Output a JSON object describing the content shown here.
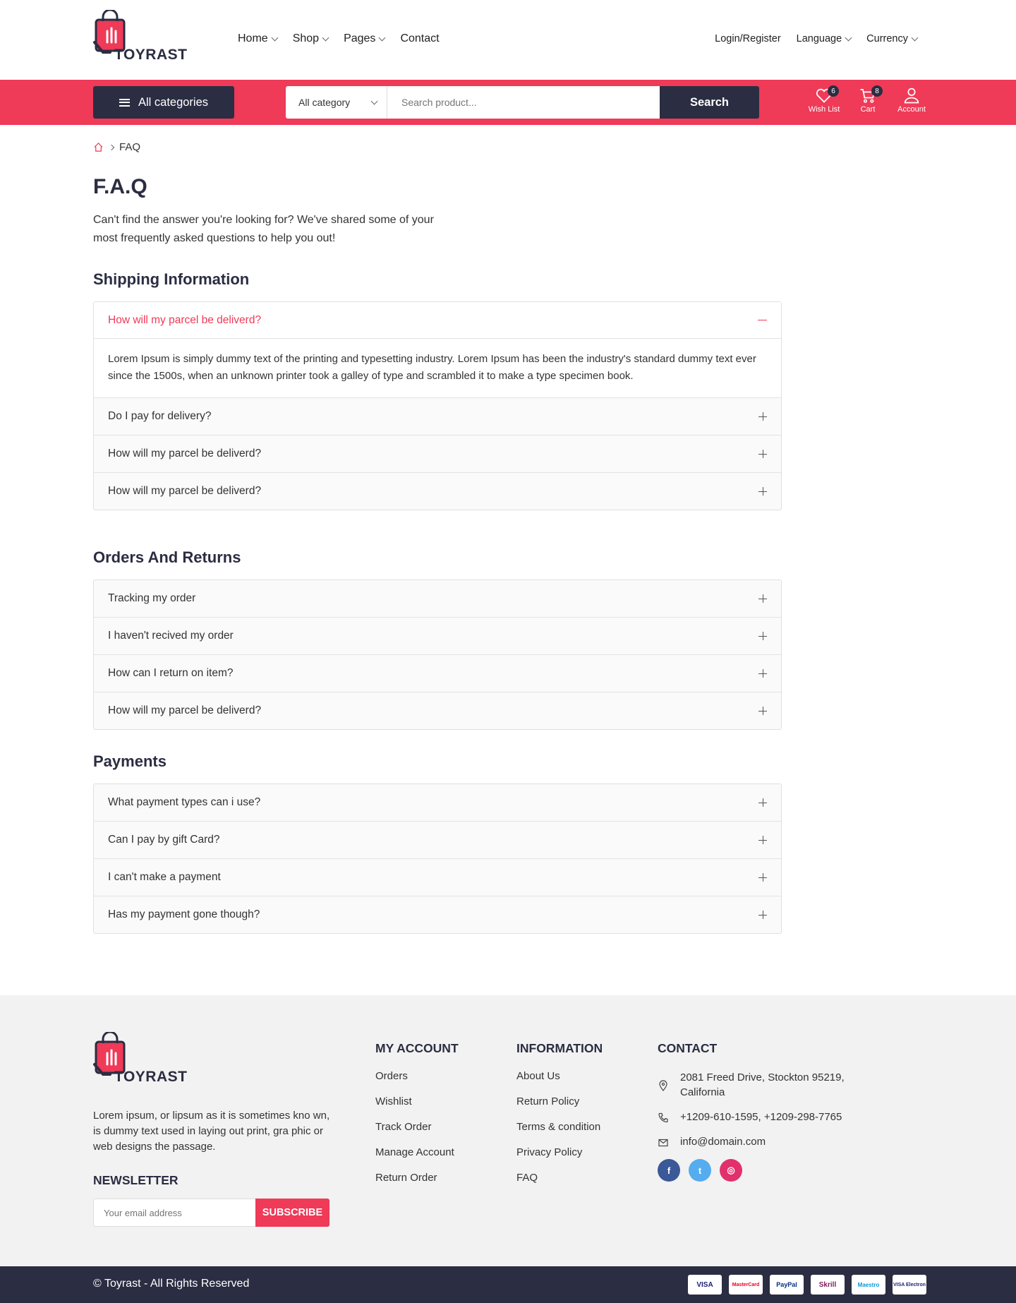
{
  "brand": {
    "name": "TOYRAST",
    "accent": "#ef3a58",
    "dark": "#2b2d42"
  },
  "nav": {
    "items": [
      {
        "label": "Home"
      },
      {
        "label": "Shop"
      },
      {
        "label": "Pages"
      },
      {
        "label": "Contact"
      }
    ],
    "login": "Login/Register",
    "language": "Language",
    "currency": "Currency"
  },
  "bar": {
    "all_categories": "All categories",
    "category_select": "All category",
    "search_placeholder": "Search product...",
    "search_button": "Search",
    "wishlist_label": "Wish List",
    "wishlist_count": "6",
    "cart_label": "Cart",
    "cart_count": "8",
    "account_label": "Account"
  },
  "breadcrumb": {
    "current": "FAQ"
  },
  "page": {
    "title": "F.A.Q",
    "subtitle": "Can't find the answer you're looking for? We've shared some of your most frequently asked questions to help you out!"
  },
  "sections": [
    {
      "title": "Shipping Information",
      "items": [
        {
          "q": "How will my parcel be deliverd?",
          "a": "Lorem Ipsum is simply dummy text of the printing and typesetting industry. Lorem Ipsum has been the industry's standard dummy text ever since the 1500s, when an unknown printer took a galley of type and scrambled it to make a type specimen book.",
          "open": true
        },
        {
          "q": "Do I pay for delivery?"
        },
        {
          "q": "How will my parcel be deliverd?"
        },
        {
          "q": "How will my parcel be deliverd?"
        }
      ]
    },
    {
      "title": "Orders And Returns",
      "items": [
        {
          "q": "Tracking my order"
        },
        {
          "q": "I haven't recived my order"
        },
        {
          "q": "How can I return on item?"
        },
        {
          "q": "How will my parcel be deliverd?"
        }
      ]
    },
    {
      "title": "Payments",
      "items": [
        {
          "q": "What payment types can i use?"
        },
        {
          "q": "Can I pay by gift Card?"
        },
        {
          "q": "I can't make a payment"
        },
        {
          "q": "Has my payment gone though?"
        }
      ]
    }
  ],
  "footer": {
    "description": "Lorem ipsum, or lipsum as it is sometimes kno wn, is dummy text used in laying out print, gra phic or web designs the passage.",
    "newsletter_title": "NEWSLETTER",
    "newsletter_placeholder": "Your email address",
    "subscribe": "SUBSCRIBE",
    "my_account": {
      "title": "MY ACCOUNT",
      "links": [
        "Orders",
        "Wishlist",
        "Track Order",
        "Manage Account",
        "Return Order"
      ]
    },
    "information": {
      "title": "INFORMATION",
      "links": [
        "About Us",
        "Return Policy",
        "Terms & condition",
        "Privacy Policy",
        "FAQ"
      ]
    },
    "contact": {
      "title": "CONTACT",
      "address": "2081 Freed Drive, Stockton 95219, California",
      "phone": "+1209-610-1595, +1209-298-7765",
      "email": "info@domain.com"
    },
    "social": [
      {
        "icon": "facebook-icon",
        "glyph": "f",
        "color": "#3b5998"
      },
      {
        "icon": "twitter-icon",
        "glyph": "t",
        "color": "#55acee"
      },
      {
        "icon": "instagram-icon",
        "glyph": "◎",
        "color": "#e1306c"
      }
    ],
    "copyright": "© Toyrast - All Rights Reserved",
    "payments": [
      "VISA",
      "MasterCard",
      "PayPal",
      "Skrill",
      "Maestro",
      "VISA Electron"
    ]
  }
}
